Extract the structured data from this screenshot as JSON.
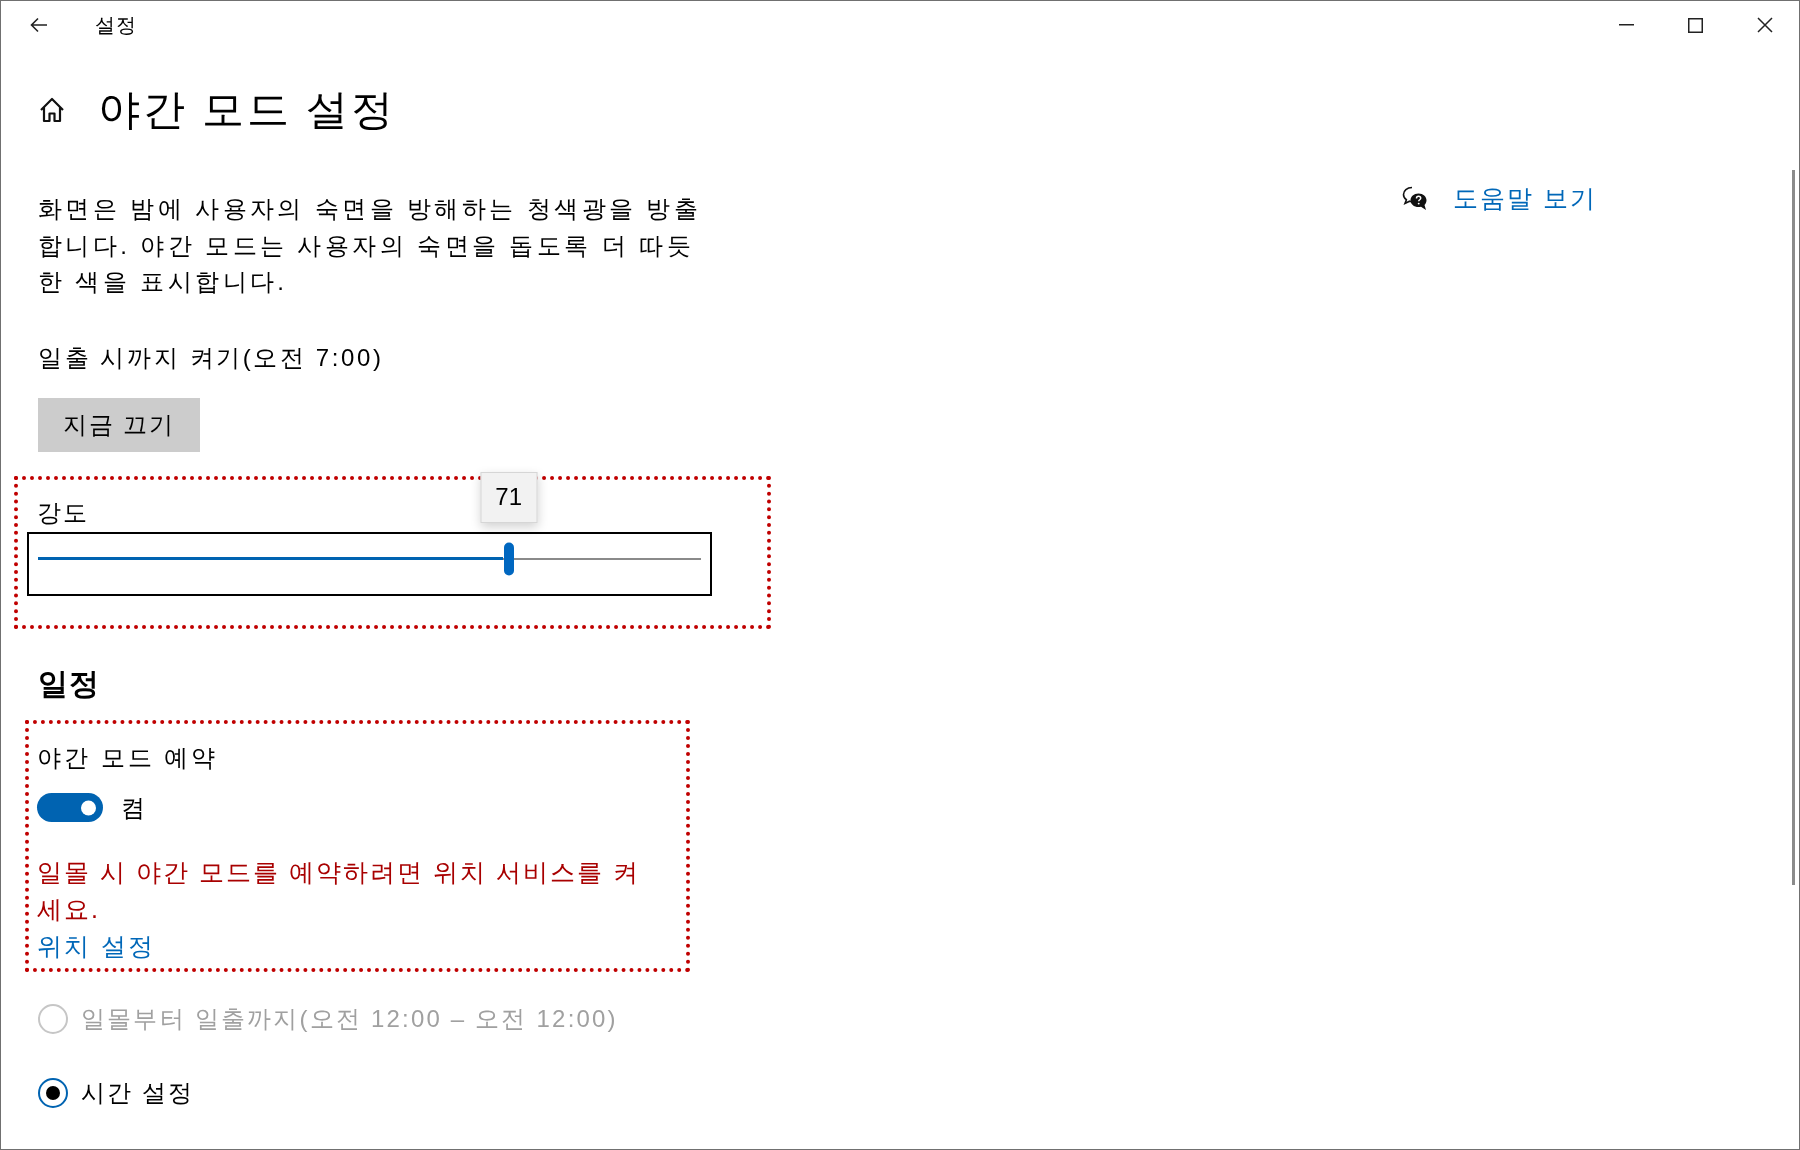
{
  "window": {
    "title": "설정"
  },
  "page": {
    "title": "야간 모드 설정",
    "description": "화면은 밤에 사용자의 숙면을 방해하는 청색광을 방출합니다. 야간 모드는 사용자의 숙면을 돕도록 더 따듯한 색을 표시합니다.",
    "status": "일출 시까지 켜기(오전 7:00)",
    "action_button": "지금 끄기"
  },
  "strength": {
    "label": "강도",
    "level": 0.71,
    "reading": "71"
  },
  "schedule": {
    "heading": "일정",
    "toggle": {
      "label": "야간 모드 예약",
      "on": true,
      "state_text": "켬"
    },
    "warning": "일몰 시 야간 모드를 예약하려면 위치 서비스를 켜세요.",
    "link": "위치 설정",
    "options": [
      {
        "label": "일몰부터 일출까지(오전 12:00 – 오전 12:00)",
        "selected": false,
        "disabled": true
      },
      {
        "label": "시간 설정",
        "selected": true,
        "disabled": false
      }
    ]
  },
  "help": {
    "link": "도움말 보기"
  }
}
